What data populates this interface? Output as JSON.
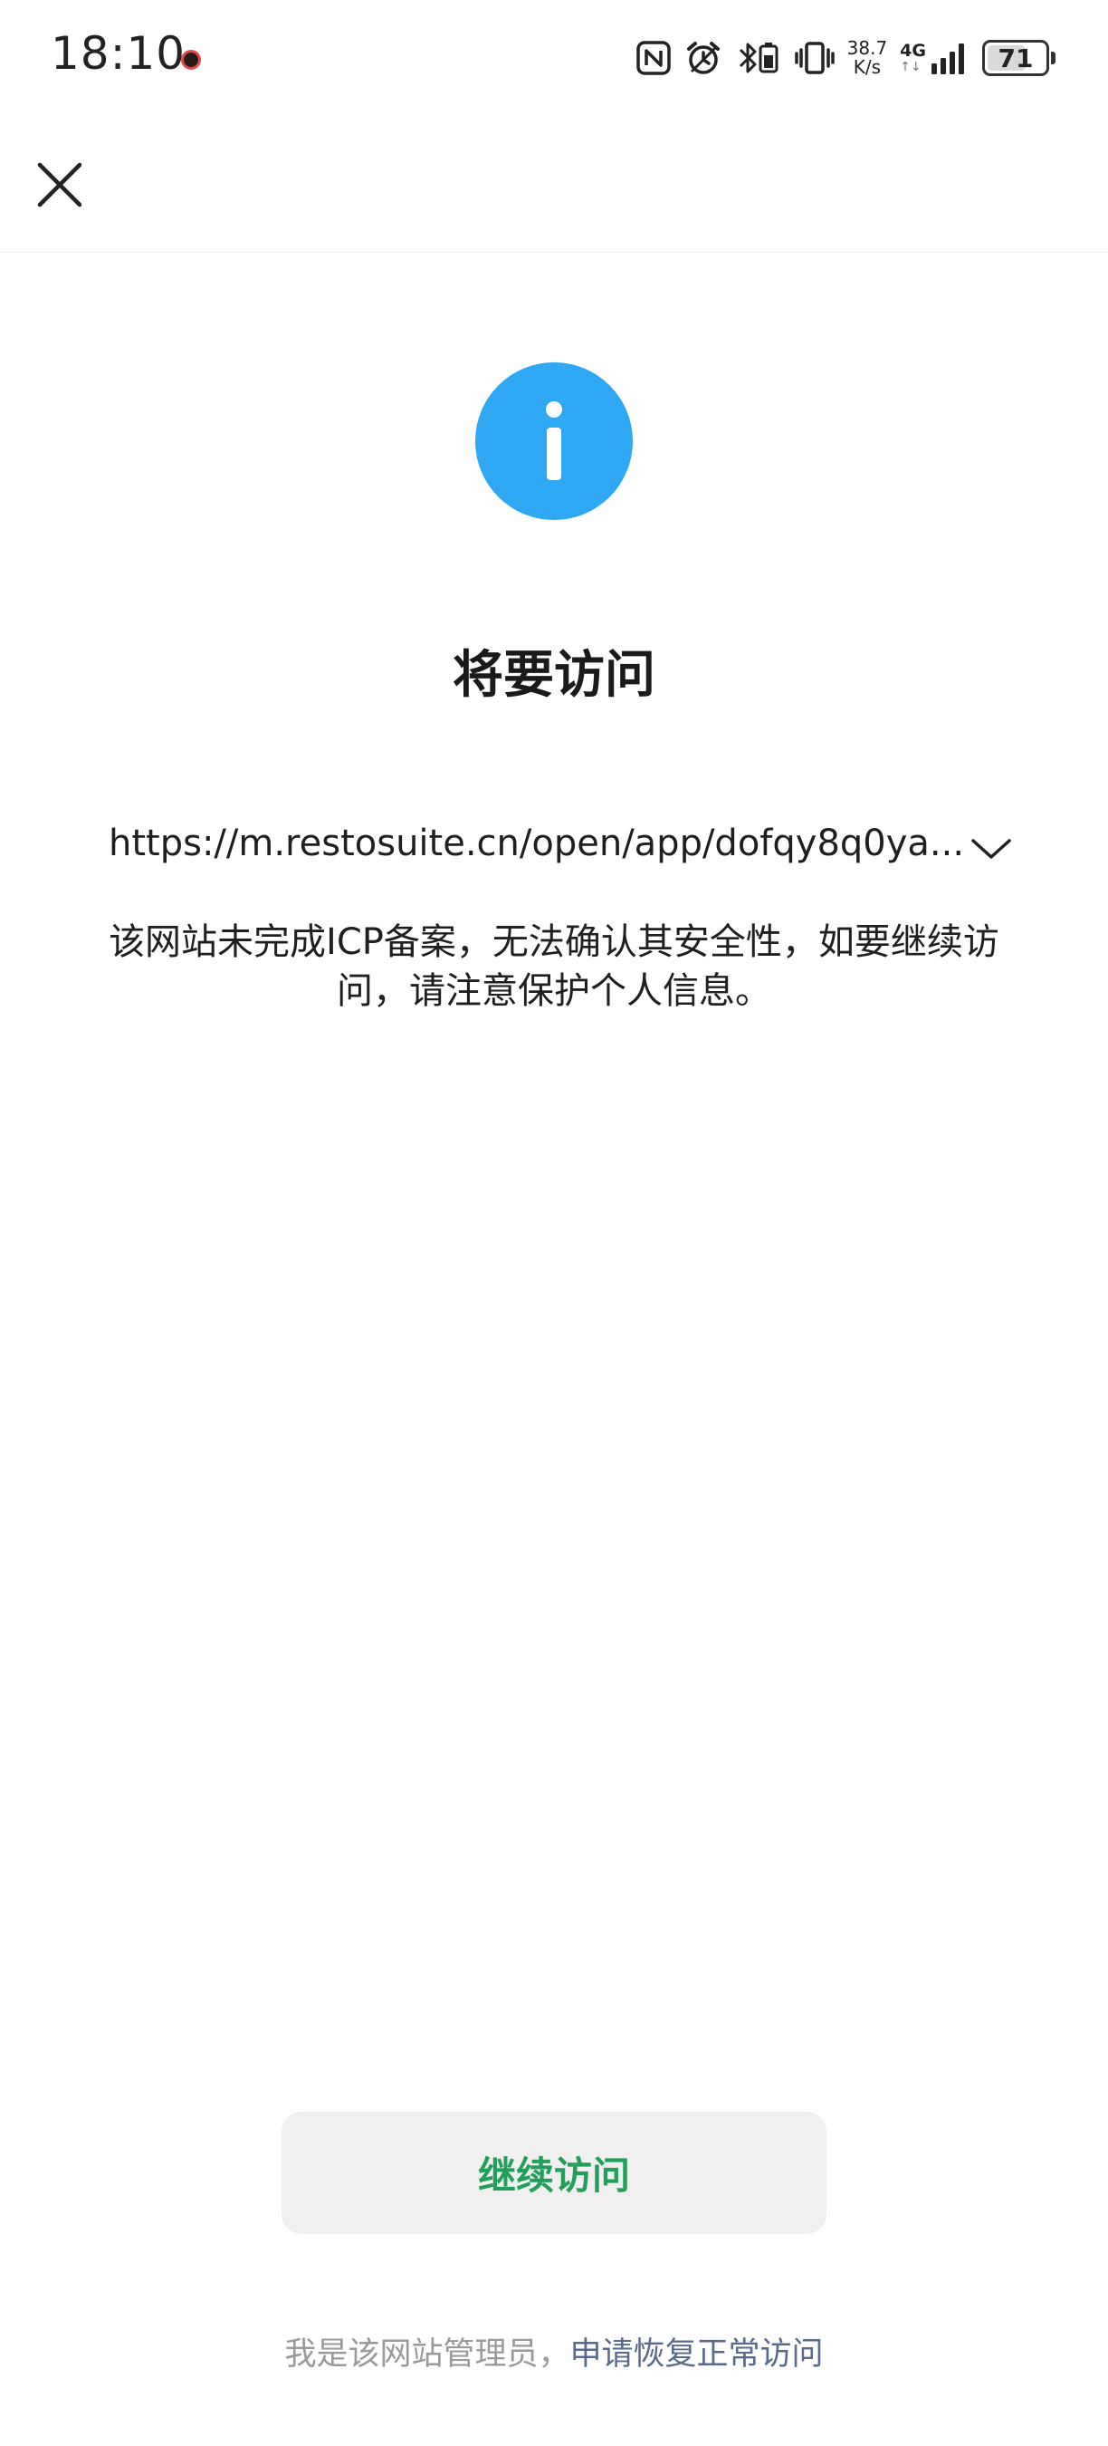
{
  "status_bar": {
    "time": "18:10",
    "net_speed_value": "38.7",
    "net_speed_unit": "K/s",
    "network_type": "4G",
    "network_sub": "↑↓",
    "battery_level": 71,
    "battery_text": "71",
    "icons": [
      "nfc-icon",
      "alarm-icon",
      "bluetooth-icon",
      "vibrate-icon",
      "signal-icon",
      "battery-icon"
    ]
  },
  "nav": {
    "close_icon": "close-icon"
  },
  "main": {
    "icon": "info-icon",
    "icon_color": "#2ea8f2",
    "title": "将要访问",
    "url": "https://m.restosuite.cn/open/app/dofqy8q0ya...",
    "warning": "该网站未完成ICP备案，无法确认其安全性，如要继续访问，请注意保护个人信息。"
  },
  "actions": {
    "continue_label": "继续访问",
    "continue_color": "#22a05a",
    "admin_prefix": "我是该网站管理员，",
    "admin_link": "申请恢复正常访问",
    "link_color": "#586b8c"
  }
}
